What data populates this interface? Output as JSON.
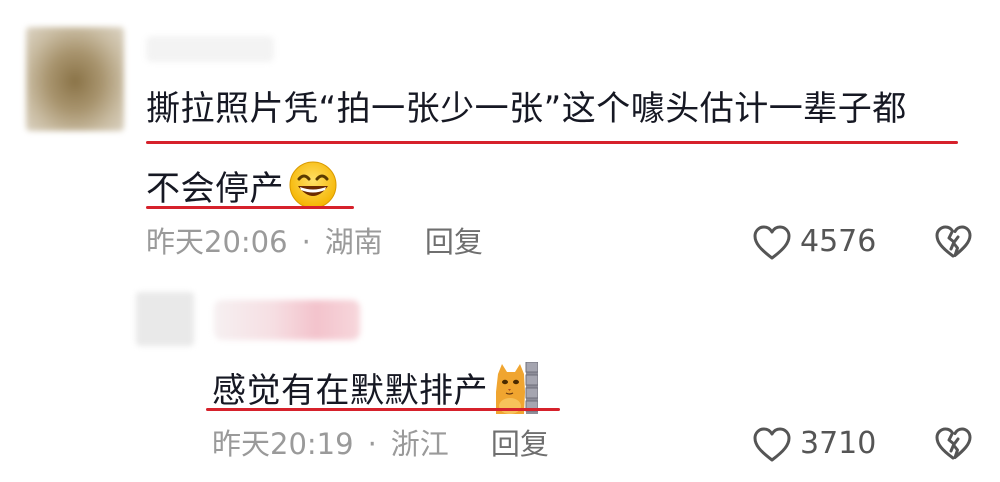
{
  "comments": [
    {
      "text_line1": "撕拉照片凭“拍一张少一张”这个噱头估计一辈子都",
      "text_line2": "不会停产",
      "emoji": "grinning-face-emoji",
      "time": "昨天20:06",
      "location": "湖南",
      "reply_label": "回复",
      "likes": "4576"
    },
    {
      "text": "感觉有在默默排产",
      "emoji": "cat-wall-peek-emoji",
      "time": "昨天20:19",
      "location": "浙江",
      "reply_label": "回复",
      "likes": "3710"
    }
  ],
  "separator": "·",
  "icons": {
    "like": "heart-outline-icon",
    "dislike": "broken-heart-icon"
  },
  "colors": {
    "underline": "#d6212b",
    "text": "#161823",
    "meta": "#9a9a9a"
  }
}
